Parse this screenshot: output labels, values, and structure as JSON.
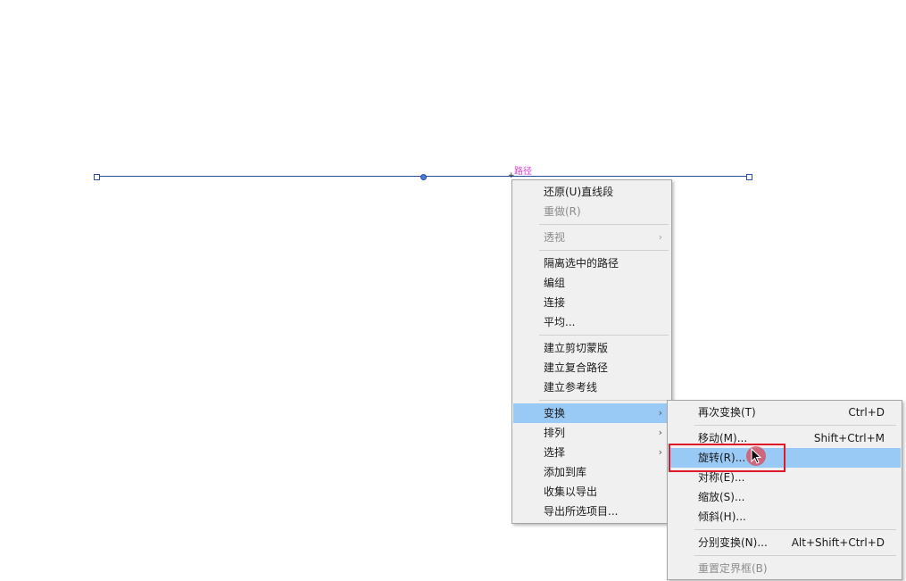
{
  "canvas": {
    "path_hint": "路径",
    "pointer_mark": "+"
  },
  "context_menu": {
    "items": [
      {
        "label": "还原(U)直线段",
        "enabled": true
      },
      {
        "label": "重做(R)",
        "enabled": false
      },
      {
        "label": "透视",
        "enabled": false,
        "submenu_arrow": "›"
      },
      {
        "label": "隔离选中的路径",
        "enabled": true
      },
      {
        "label": "编组",
        "enabled": true
      },
      {
        "label": "连接",
        "enabled": true
      },
      {
        "label": "平均...",
        "enabled": true
      },
      {
        "label": "建立剪切蒙版",
        "enabled": true
      },
      {
        "label": "建立复合路径",
        "enabled": true
      },
      {
        "label": "建立参考线",
        "enabled": true
      },
      {
        "label": "变换",
        "enabled": true,
        "active": true,
        "submenu_arrow": "›"
      },
      {
        "label": "排列",
        "enabled": true,
        "submenu_arrow": "›"
      },
      {
        "label": "选择",
        "enabled": true,
        "submenu_arrow": "›"
      },
      {
        "label": "添加到库",
        "enabled": true
      },
      {
        "label": "收集以导出",
        "enabled": true
      },
      {
        "label": "导出所选项目...",
        "enabled": true
      }
    ]
  },
  "transform_submenu": {
    "items": [
      {
        "label": "再次变换(T)",
        "shortcut": "Ctrl+D"
      },
      {
        "label": "移动(M)...",
        "shortcut": "Shift+Ctrl+M"
      },
      {
        "label": "旋转(R)...",
        "shortcut": "",
        "active": true
      },
      {
        "label": "对称(E)...",
        "shortcut": ""
      },
      {
        "label": "缩放(S)...",
        "shortcut": ""
      },
      {
        "label": "倾斜(H)...",
        "shortcut": ""
      },
      {
        "label": "分别变换(N)...",
        "shortcut": "Alt+Shift+Ctrl+D"
      },
      {
        "label": "重置定界框(B)",
        "shortcut": "",
        "enabled": false
      }
    ]
  },
  "colors": {
    "menu_background": "#f0f0f0",
    "highlight": "#99c9f5",
    "path_stroke": "#2b4f9c",
    "hint_text": "#e23bd8",
    "annotation_red": "#e0182a"
  },
  "icons": {
    "cursor": "mouse-pointer-icon",
    "submenu": "chevron-right-icon"
  }
}
